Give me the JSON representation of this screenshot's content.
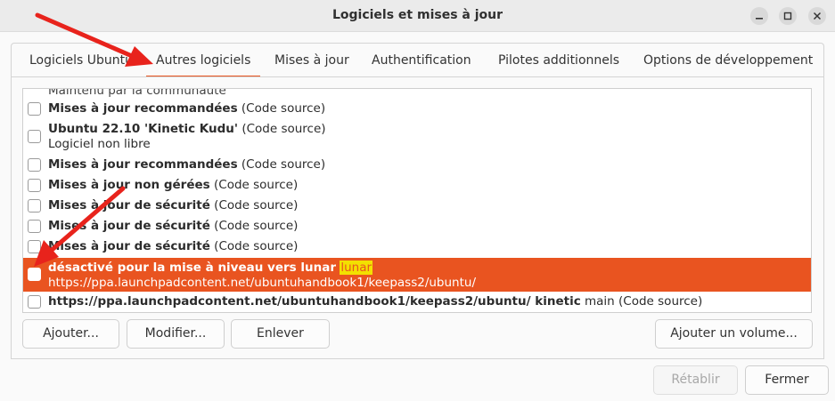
{
  "window": {
    "title": "Logiciels et mises à jour"
  },
  "tabs": [
    {
      "label": "Logiciels Ubuntu"
    },
    {
      "label": "Autres logiciels",
      "active": true
    },
    {
      "label": "Mises à jour"
    },
    {
      "label": "Authentification"
    },
    {
      "label": "Pilotes additionnels"
    },
    {
      "label": "Options de développement"
    }
  ],
  "sources": {
    "partial_top": "Maintenu par la communauté",
    "items": [
      {
        "bold": "Mises à jour recommandées",
        "rest": " (Code source)",
        "checked": false
      },
      {
        "bold": "Ubuntu 22.10 'Kinetic Kudu'",
        "rest": " (Code source)",
        "line2": "Logiciel non libre",
        "checked": false
      },
      {
        "bold": "Mises à jour recommandées",
        "rest": " (Code source)",
        "checked": false
      },
      {
        "bold": "Mises à jour non gérées",
        "rest": " (Code source)",
        "checked": false
      },
      {
        "bold": "Mises à jour de sécurité",
        "rest": " (Code source)",
        "checked": false
      },
      {
        "bold": "Mises à jour de sécurité",
        "rest": " (Code source)",
        "checked": false
      },
      {
        "bold": "Mises à jour de sécurité",
        "rest": " (Code source)",
        "checked": false
      },
      {
        "bold": "désactivé pour la mise à niveau vers lunar",
        "highlight": "lunar",
        "line2": "https://ppa.launchpadcontent.net/ubuntuhandbook1/keepass2/ubuntu/",
        "checked": false,
        "selected": true
      },
      {
        "bold": "https://ppa.launchpadcontent.net/ubuntuhandbook1/keepass2/ubuntu/ kinetic",
        "rest": " main (Code source)",
        "checked": false
      }
    ]
  },
  "buttons": {
    "add": "Ajouter...",
    "edit": "Modifier...",
    "remove": "Enlever",
    "add_volume": "Ajouter un volume...",
    "revert": "Rétablir",
    "close": "Fermer"
  },
  "colors": {
    "accent": "#e95420",
    "highlight": "#f3e000",
    "annotation_arrow": "#e8231c"
  }
}
